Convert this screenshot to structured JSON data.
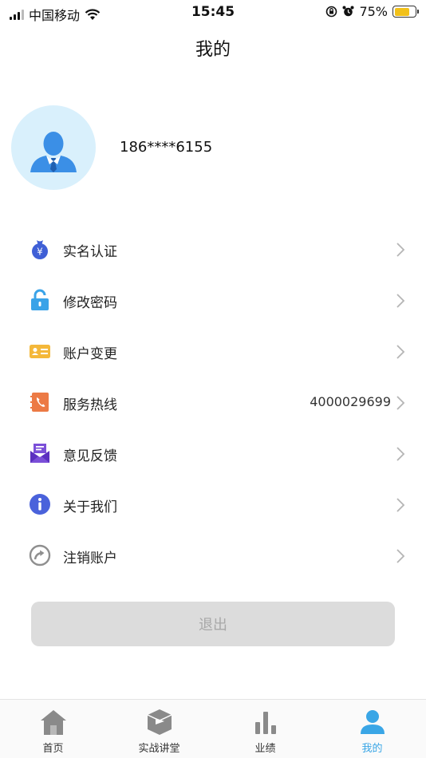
{
  "status_bar": {
    "carrier": "中国移动",
    "time": "15:45",
    "battery": "75%",
    "battery_level": 0.75
  },
  "header": {
    "title": "我的"
  },
  "profile": {
    "phone": "186****6155",
    "avatar_icon": "user-avatar-icon"
  },
  "menu": {
    "items": [
      {
        "label": "实名认证",
        "icon": "money-bag-icon",
        "value": ""
      },
      {
        "label": "修改密码",
        "icon": "unlock-icon",
        "value": ""
      },
      {
        "label": "账户变更",
        "icon": "id-card-icon",
        "value": ""
      },
      {
        "label": "服务热线",
        "icon": "phone-book-icon",
        "value": "4000029699"
      },
      {
        "label": "意见反馈",
        "icon": "mail-icon",
        "value": ""
      },
      {
        "label": "关于我们",
        "icon": "info-icon",
        "value": ""
      },
      {
        "label": "注销账户",
        "icon": "arrow-circle-icon",
        "value": ""
      }
    ]
  },
  "logout": {
    "label": "退出"
  },
  "tab_bar": {
    "tabs": [
      {
        "label": "首页",
        "icon": "home-icon"
      },
      {
        "label": "实战讲堂",
        "icon": "lecture-icon"
      },
      {
        "label": "业绩",
        "icon": "bar-chart-icon"
      },
      {
        "label": "我的",
        "icon": "user-icon"
      }
    ],
    "active": "我的"
  },
  "colors": {
    "accent": "#3aa6e6",
    "avatar_bg": "#d9f0fc",
    "avatar_figure": "#3b8fe6",
    "logout_bg": "#dcdcdc",
    "battery": "#f2c11a"
  }
}
